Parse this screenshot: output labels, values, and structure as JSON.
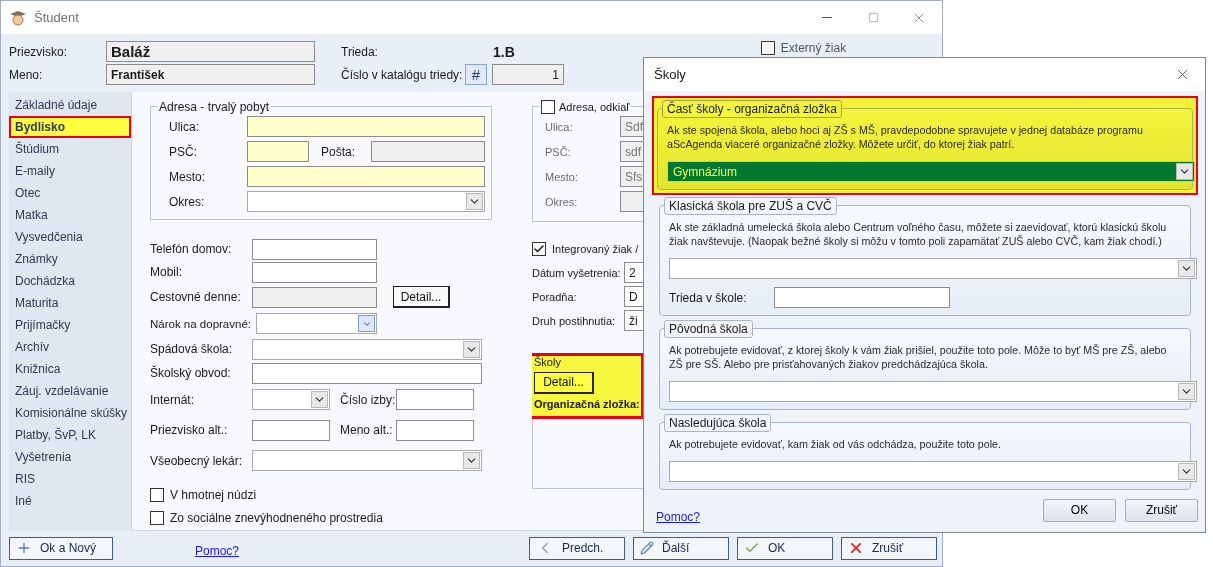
{
  "window": {
    "title": "Študent"
  },
  "header": {
    "surname_label": "Priezvisko:",
    "surname": "Baláž",
    "name_label": "Meno:",
    "name": "František",
    "class_label": "Trieda:",
    "class": "1.B",
    "catalog_label": "Číslo v katalógu triedy:",
    "catalog_button": "#",
    "catalog_number": "1",
    "external": {
      "label": "Externý žiak",
      "checked": false
    }
  },
  "sidebar": {
    "items": [
      {
        "label": "Základné údaje",
        "selected": false
      },
      {
        "label": "Bydlisko",
        "selected": true
      },
      {
        "label": "Štúdium",
        "selected": false
      },
      {
        "label": "E-maily",
        "selected": false
      },
      {
        "label": "Otec",
        "selected": false
      },
      {
        "label": "Matka",
        "selected": false
      },
      {
        "label": "Vysvedčenia",
        "selected": false
      },
      {
        "label": "Známky",
        "selected": false
      },
      {
        "label": "Dochádzka",
        "selected": false
      },
      {
        "label": "Maturita",
        "selected": false
      },
      {
        "label": "Prijímačky",
        "selected": false
      },
      {
        "label": "Archív",
        "selected": false
      },
      {
        "label": "Knižnica",
        "selected": false
      },
      {
        "label": "Záuj. vzdelávanie",
        "selected": false
      },
      {
        "label": "Komisionálne skúšky",
        "selected": false
      },
      {
        "label": "Platby, ŠvP, LK",
        "selected": false
      },
      {
        "label": "Vyšetrenia",
        "selected": false
      },
      {
        "label": "RIS",
        "selected": false
      },
      {
        "label": "Iné",
        "selected": false
      }
    ]
  },
  "permanent_address": {
    "title": "Adresa - trvalý pobyt",
    "street_label": "Ulica:",
    "zip_label": "PSČ:",
    "post_label": "Pošta:",
    "city_label": "Mesto:",
    "district_label": "Okres:"
  },
  "other_address": {
    "title": "Adresa, odkiaľ",
    "checked": false,
    "street_label": "Ulica:",
    "street": "Sdf",
    "zip_label": "PSČ:",
    "zip": "sdf",
    "city_label": "Mesto:",
    "city": "Sfs",
    "district_label": "Okres:"
  },
  "contact": {
    "phone_label": "Telefón domov:",
    "mobile_label": "Mobil:",
    "travel_label": "Cestovné denne:",
    "travel_button": "Detail...",
    "transport_label": "Nárok na dopravné:",
    "catchment_label": "Spádová škola:",
    "district_label": "Školský obvod:",
    "dorm_label": "Internát:",
    "room_label": "Číslo izby:",
    "alt_surname_label": "Priezvisko alt.:",
    "alt_name_label": "Meno alt.:",
    "doctor_label": "Všeobecný lekár:"
  },
  "checkboxes": [
    {
      "label": "V hmotnej núdzi",
      "checked": false
    },
    {
      "label": "Zo sociálne znevýhodneného prostredia",
      "checked": false
    }
  ],
  "integration": {
    "label": "Integrovaný žiak /",
    "checked": true,
    "exam_date_label": "Dátum vyšetrenia:",
    "exam_date": "2",
    "counseling_label": "Poradňa:",
    "counseling": "D",
    "disability_label": "Druh postihnutia:",
    "disability": "ži"
  },
  "schools_box": {
    "title": "Školy",
    "button": "Detail...",
    "org_label": "Organizačná zložka:",
    "highlighted": true
  },
  "footer": {
    "ok_new": "Ok a Nový",
    "help": "Pomoc?",
    "prev": "Predch.",
    "next": "Ďalší",
    "ok": "OK",
    "cancel": "Zrušiť"
  },
  "dialog": {
    "title": "Školy",
    "groups": [
      {
        "title": "Časť školy - organizačná zložka",
        "description": "Ak ste spojená škola, alebo hoci aj ZŠ s MŠ, pravdepodobne spravujete v jednej databáze programu aScAgenda viaceré organizačné zložky. Môžete určiť, do ktorej žiak patrí.",
        "value": "Gymnázium",
        "highlighted": true
      },
      {
        "title": "Klasická škola pre ZUŠ a CVČ",
        "description": "Ak ste základná umelecká škola alebo Centrum voľného času, môžete si zaevidovať, ktorú klasickú školu žiak navštevuje. (Naopak bežné školy si môžu v tomto poli zapamätať ZUŠ alebo CVČ, kam žiak chodí.)",
        "highlighted": false,
        "class_label": "Trieda v škole:"
      },
      {
        "title": "Pôvodná škola",
        "description": "Ak potrebujete evidovať, z ktorej školy k vám žiak prišiel, použite toto pole. Môže to byť MŠ pre ZŠ, alebo ZŠ pre SŠ. Alebo pre prisťahovaných žiakov predchádzajúca škola.",
        "highlighted": false
      },
      {
        "title": "Nasledujúca škola",
        "description": "Ak potrebujete evidovať, kam žiak od vás odchádza, použite toto pole.",
        "highlighted": false
      }
    ],
    "help": "Pomoc?",
    "ok": "OK",
    "cancel": "Zrušiť"
  }
}
